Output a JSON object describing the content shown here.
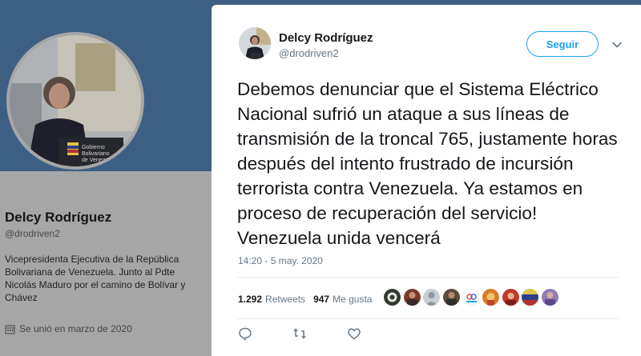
{
  "profile": {
    "name": "Delcy Rodríguez",
    "handle": "@drodriven2",
    "bio": "Vicepresidenta Ejecutiva de la República Bolivariana de Venezuela. Junto al Pdte Nicolás Maduro por el camino de Bolívar y Chávez",
    "joined": "Se unió en marzo de 2020",
    "podium_text": "Gobierno Bolivariano de Venezuela"
  },
  "tweet": {
    "author_name": "Delcy Rodríguez",
    "author_handle": "@drodriven2",
    "follow_label": "Seguir",
    "text": "Debemos denunciar que el Sistema Eléctrico Nacional sufrió un ataque a sus líneas de transmisión de la troncal 765, justamente horas después del intento frustrado de incursión terrorista contra Venezuela. Ya estamos en proceso de recuperación del servicio! Venezuela unida vencerá",
    "timestamp": "14:20 - 5 may. 2020",
    "retweets_count": "1.292",
    "retweets_label": "Retweets",
    "likes_count": "947",
    "likes_label": "Me gusta"
  },
  "colors": {
    "accent": "#1da1f2",
    "muted_text": "#657786",
    "primary_text": "#14171a",
    "overlay_header": "#3d5f83"
  },
  "icons": [
    "calendar-icon",
    "chevron-down-icon",
    "reply-icon",
    "retweet-icon",
    "like-icon"
  ]
}
